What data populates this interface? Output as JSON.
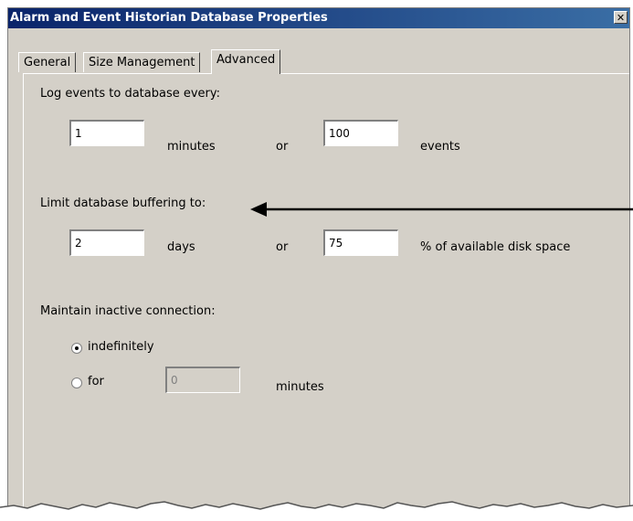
{
  "window": {
    "title": "Alarm and Event Historian Database Properties",
    "close_glyph": "✕"
  },
  "tabs": [
    {
      "label": "General"
    },
    {
      "label": "Size Management"
    },
    {
      "label": "Advanced",
      "active": true
    }
  ],
  "log_events": {
    "heading": "Log events to database every:",
    "minutes_value": "1",
    "minutes_label": "minutes",
    "or_label": "or",
    "events_value": "100",
    "events_label": "events"
  },
  "buffering": {
    "heading": "Limit database buffering to:",
    "days_value": "2",
    "days_label": "days",
    "or_label": "or",
    "percent_value": "75",
    "percent_label": "% of available disk space"
  },
  "connection": {
    "heading": "Maintain inactive connection:",
    "option_indefinitely": "indefinitely",
    "option_for": "for",
    "for_value": "0",
    "minutes_label": "minutes",
    "selected": "indefinitely"
  },
  "colors": {
    "titlebar_start": "#0a246a",
    "titlebar_end": "#3a6ea5",
    "dialog_bg": "#d4d0c8"
  }
}
